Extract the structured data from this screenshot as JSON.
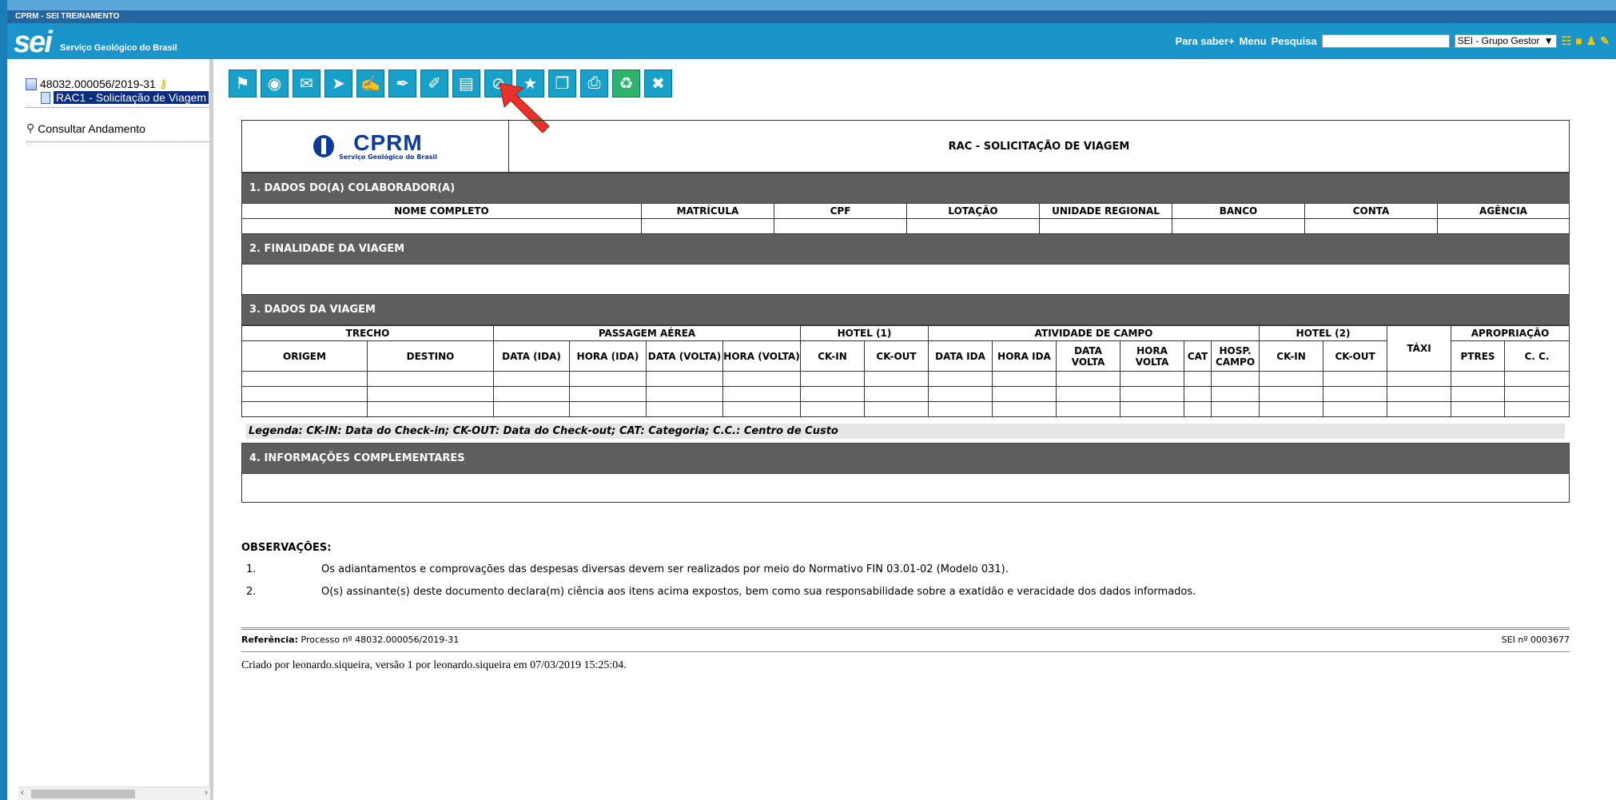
{
  "env_label": "CPRM - SEI TREINAMENTO",
  "brand": {
    "logo": "sei",
    "name": "Serviço Geológico do Brasil"
  },
  "top_nav": {
    "help": "Para saber+",
    "menu": "Menu",
    "search_label": "Pesquisa",
    "search_value": "",
    "unit": "SEI - Grupo Gestor"
  },
  "tree": {
    "process": "48032.000056/2019-31",
    "document": "RAC1 - Solicitação de Viagem",
    "consult": "Consultar Andamento"
  },
  "toolbar_icons": [
    "incluir-documento-icon",
    "acompanhamento-icon",
    "enviar-email-icon",
    "enviar-processo-icon",
    "editar-documento-icon",
    "assinar-icon",
    "bloco-assinatura-icon",
    "imprimir-icon",
    "cancelar-icon",
    "modelo-favorito-icon",
    "copiar-icon",
    "gerar-pdf-icon",
    "reabrir-icon",
    "excluir-icon"
  ],
  "document": {
    "org_name": "CPRM",
    "org_sub": "Serviço Geológico do Brasil",
    "title": "RAC - SOLICITAÇÃO DE VIAGEM",
    "section1": "1. DADOS DO(A) COLABORADOR(A)",
    "section1_cols": [
      "NOME COMPLETO",
      "MATRÍCULA",
      "CPF",
      "LOTAÇÃO",
      "UNIDADE REGIONAL",
      "BANCO",
      "CONTA",
      "AGÊNCIA"
    ],
    "section2": "2. FINALIDADE DA VIAGEM",
    "section3": "3. DADOS DA VIAGEM",
    "groups": {
      "trecho": "TRECHO",
      "passagem": "PASSAGEM AÉREA",
      "hotel1": "HOTEL (1)",
      "atividade": "ATIVIDADE DE CAMPO",
      "hotel2": "HOTEL (2)",
      "taxi": "TÁXI",
      "apropriacao": "APROPRIAÇÃO"
    },
    "sub": {
      "origem": "ORIGEM",
      "destino": "DESTINO",
      "data_ida": "DATA (IDA)",
      "hora_ida": "HORA (IDA)",
      "data_volta": "DATA (VOLTA)",
      "hora_volta": "HORA (VOLTA)",
      "ckin": "CK-IN",
      "ckout": "CK-OUT",
      "data_ida2": "DATA IDA",
      "hora_ida2": "HORA IDA",
      "data_volta2": "DATA VOLTA",
      "hora_volta2": "HORA VOLTA",
      "cat": "CAT",
      "hosp": "HOSP. CAMPO",
      "ckin2": "CK-IN",
      "ckout2": "CK-OUT",
      "ptres": "PTRES",
      "cc": "C. C."
    },
    "legend": "Legenda: CK-IN: Data do Check-in; CK-OUT: Data do Check-out; CAT: Categoria; C.C.: Centro de Custo",
    "section4": "4. INFORMAÇÕES COMPLEMENTARES"
  },
  "observacoes": {
    "title": "OBSERVAÇÕES:",
    "items": [
      {
        "num": "1.",
        "text": "Os adiantamentos e comprovações das despesas diversas devem ser realizados por meio do Normativo FIN 03.01-02 (Modelo 031)."
      },
      {
        "num": "2.",
        "text": "O(s) assinante(s) deste documento declara(m) ciência aos itens acima expostos, bem como sua responsabilidade sobre a exatidão e veracidade dos dados informados."
      }
    ]
  },
  "reference": {
    "label": "Referência:",
    "text": "Processo nº 48032.000056/2019-31",
    "sei_no": "SEI nº 0003677"
  },
  "created": "Criado por leonardo.siqueira, versão 1 por leonardo.siqueira em 07/03/2019 15:25:04."
}
